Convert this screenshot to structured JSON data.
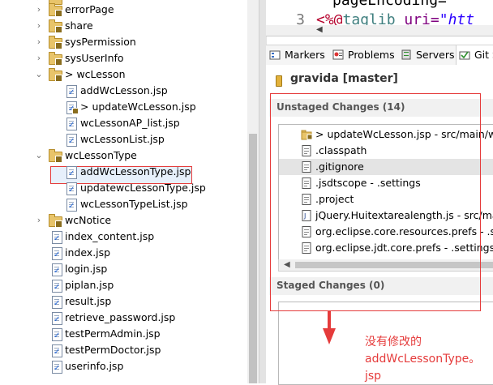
{
  "tree": {
    "items": [
      {
        "label": "errorPage",
        "kind": "folder",
        "expanded": false
      },
      {
        "label": "share",
        "kind": "folder",
        "expanded": false
      },
      {
        "label": "sysPermission",
        "kind": "folder",
        "expanded": false
      },
      {
        "label": "sysUserInfo",
        "kind": "folder",
        "expanded": false
      },
      {
        "label": "> wcLesson",
        "kind": "folder",
        "expanded": true
      },
      {
        "label": "addWcLesson.jsp",
        "kind": "file"
      },
      {
        "label": "> updateWcLesson.jsp",
        "kind": "file-modified"
      },
      {
        "label": "wcLessonAP_list.jsp",
        "kind": "file"
      },
      {
        "label": "wcLessonList.jsp",
        "kind": "file"
      },
      {
        "label": "wcLessonType",
        "kind": "folder",
        "expanded": true
      },
      {
        "label": "addWcLessonType.jsp",
        "kind": "file",
        "selected": true
      },
      {
        "label": "updatewcLessonType.jsp",
        "kind": "file"
      },
      {
        "label": "wcLessonTypeList.jsp",
        "kind": "file"
      },
      {
        "label": "wcNotice",
        "kind": "folder",
        "expanded": false
      },
      {
        "label": "index_content.jsp",
        "kind": "file"
      },
      {
        "label": "index.jsp",
        "kind": "file"
      },
      {
        "label": "login.jsp",
        "kind": "file"
      },
      {
        "label": "piplan.jsp",
        "kind": "file"
      },
      {
        "label": "result.jsp",
        "kind": "file"
      },
      {
        "label": "retrieve_password.jsp",
        "kind": "file"
      },
      {
        "label": "testPermAdmin.jsp",
        "kind": "file"
      },
      {
        "label": "testPermDoctor.jsp",
        "kind": "file"
      },
      {
        "label": "userinfo.jsp",
        "kind": "file"
      }
    ]
  },
  "editor": {
    "line2_text": "pageEncoding= \"",
    "line3_number": "3",
    "line3_text": "<%@taglib uri=\"htt"
  },
  "tabs": [
    {
      "label": "Markers",
      "icon": "markers-icon"
    },
    {
      "label": "Problems",
      "icon": "problems-icon"
    },
    {
      "label": "Servers",
      "icon": "servers-icon"
    },
    {
      "label": "Git S",
      "icon": "git-staging-icon",
      "active": true
    }
  ],
  "git": {
    "repo_title": "gravida [master]",
    "unstaged_header": "Unstaged Changes (14)",
    "unstaged": [
      {
        "label": "> updateWcLesson.jsp - src/main/web",
        "icon": "jsp-modified-icon"
      },
      {
        "label": ".classpath",
        "icon": "text-file-icon"
      },
      {
        "label": ".gitignore",
        "icon": "text-file-icon",
        "selected": true
      },
      {
        "label": ".jsdtscope - .settings",
        "icon": "text-file-icon"
      },
      {
        "label": ".project",
        "icon": "text-file-icon"
      },
      {
        "label": "jQuery.Huitextarealength.js - src/main/",
        "icon": "js-file-icon"
      },
      {
        "label": "org.eclipse.core.resources.prefs - .set",
        "icon": "text-file-icon"
      },
      {
        "label": "org.eclipse.jdt.core.prefs - .settings",
        "icon": "text-file-icon"
      }
    ],
    "staged_header": "Staged Changes (0)"
  },
  "annotation": {
    "line1": "没有修改的",
    "line2": "addWcLessonType。",
    "line3": "jsp"
  },
  "colors": {
    "annotation_red": "#e53b3b",
    "folder_yellow": "#e8c46a",
    "selection_gray": "#e4e4e4"
  }
}
